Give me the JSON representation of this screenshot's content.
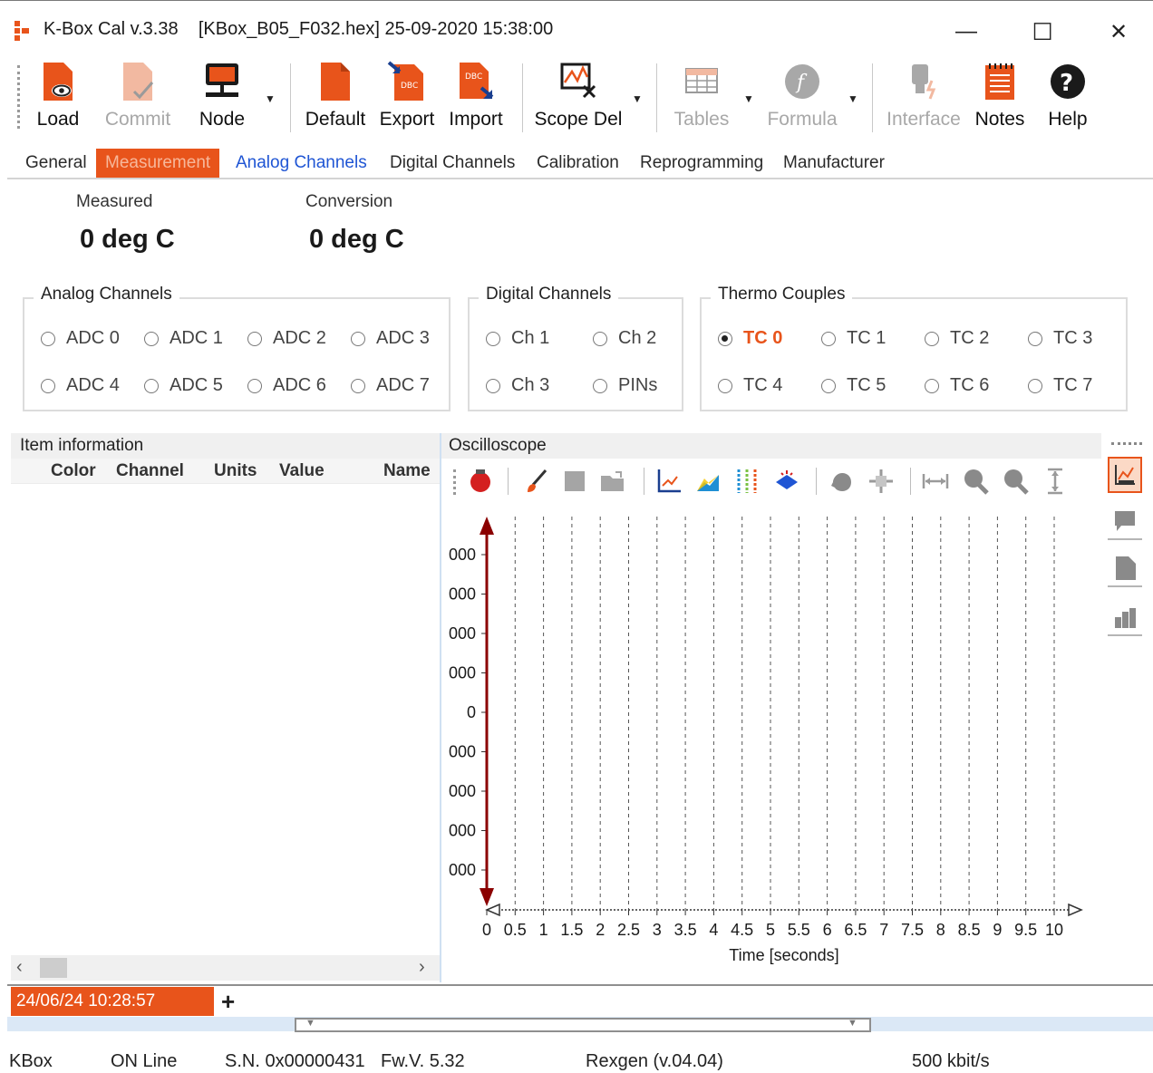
{
  "window": {
    "app": "K-Box Cal v.3.38",
    "file": "[KBox_B05_F032.hex] 25-09-2020 15:38:00",
    "minimize": "—",
    "maximize": "☐",
    "close": "✕"
  },
  "toolbar": {
    "load": "Load",
    "commit": "Commit",
    "node": "Node",
    "default": "Default",
    "export": "Export",
    "import": "Import",
    "scope_del": "Scope Del",
    "tables": "Tables",
    "formula": "Formula",
    "interface": "Interface",
    "notes": "Notes",
    "help": "Help"
  },
  "tabs": [
    "General",
    "Measurement",
    "Analog Channels",
    "Digital Channels",
    "Calibration",
    "Reprogramming",
    "Manufacturer"
  ],
  "measurement": {
    "measured_label": "Measured",
    "measured_value": "0 deg C",
    "conversion_label": "Conversion",
    "conversion_value": "0 deg C"
  },
  "groups": {
    "analog": {
      "title": "Analog Channels",
      "options": [
        "ADC 0",
        "ADC 1",
        "ADC 2",
        "ADC 3",
        "ADC 4",
        "ADC 5",
        "ADC 6",
        "ADC 7"
      ]
    },
    "digital": {
      "title": "Digital Channels",
      "options": [
        "Ch 1",
        "Ch 2",
        "Ch 3",
        "PINs"
      ]
    },
    "thermo": {
      "title": "Thermo Couples",
      "options": [
        "TC 0",
        "TC 1",
        "TC 2",
        "TC 3",
        "TC 4",
        "TC 5",
        "TC 6",
        "TC 7"
      ],
      "selected": "TC 0"
    }
  },
  "item_info": {
    "title": "Item information",
    "columns": [
      "Color",
      "Channel",
      "Units",
      "Value",
      "Name"
    ]
  },
  "oscilloscope": {
    "title": "Oscilloscope",
    "y_tick_labels": [
      "000",
      "000",
      "000",
      "000",
      "0",
      "000",
      "000",
      "000",
      "000"
    ],
    "x_tick_labels": [
      "0",
      "0.5",
      "1",
      "1.5",
      "2",
      "2.5",
      "3",
      "3.5",
      "4",
      "4.5",
      "5",
      "5.5",
      "6",
      "6.5",
      "7",
      "7.5",
      "8",
      "8.5",
      "9",
      "9.5",
      "10"
    ],
    "x_axis_label": "Time [seconds]",
    "x_range": [
      0,
      10
    ]
  },
  "session_tab": "24/06/24 10:28:57",
  "add_tab": "+",
  "status": {
    "device": "KBox",
    "state": "ON Line",
    "serial": "S.N. 0x00000431",
    "firmware": "Fw.V. 5.32",
    "protocol": "Rexgen (v.04.04)",
    "baud": "500 kbit/s"
  },
  "colors": {
    "accent": "#e8541b",
    "link": "#1f55d4",
    "axis": "#8b0000"
  }
}
